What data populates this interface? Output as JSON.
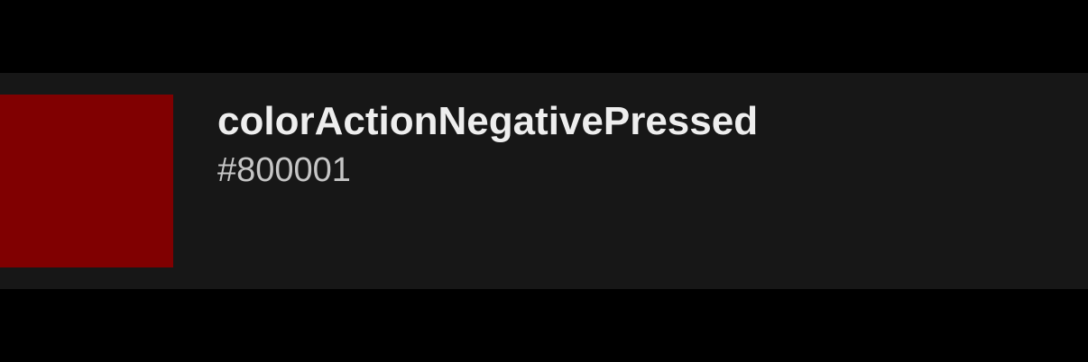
{
  "token": {
    "name": "colorActionNegativePressed",
    "hex_label": "#800001",
    "swatch_color": "#800001"
  },
  "theme": {
    "page_background": "#000000",
    "row_background": "#171717",
    "name_color": "#eeeeee",
    "hex_color": "#c6c6c6"
  }
}
